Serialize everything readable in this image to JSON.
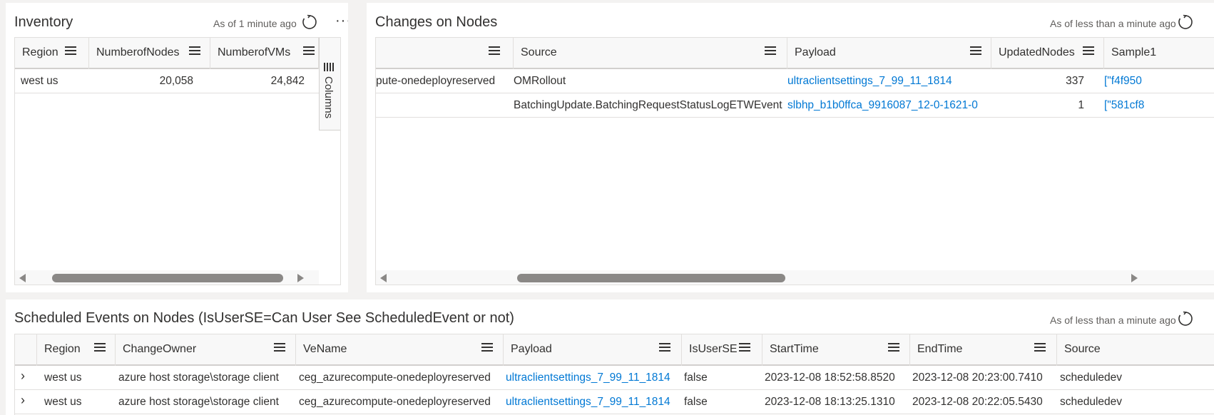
{
  "inventory": {
    "title": "Inventory",
    "status": "As of 1 minute ago",
    "more": "···",
    "columns": [
      "Region",
      "NumberofNodes",
      "NumberofVMs"
    ],
    "rows": [
      {
        "region": "west us",
        "nodes": "20,058",
        "vms": "24,842"
      }
    ],
    "columns_panel_label": "Columns"
  },
  "changes": {
    "title": "Changes on Nodes",
    "status": "As of less than a minute ago",
    "columns": [
      "",
      "Source",
      "Payload",
      "UpdatedNodes",
      "Sample1"
    ],
    "rows": [
      {
        "c0": "pute-onedeployreserved",
        "source": "OMRollout",
        "payload": "ultraclientsettings_7_99_11_1814",
        "updated": "337",
        "sample": "[\"f4f950"
      },
      {
        "c0": "",
        "source": "BatchingUpdate.BatchingRequestStatusLogETWEvent",
        "payload": "slbhp_b1b0ffca_9916087_12-0-1621-0",
        "updated": "1",
        "sample": "[\"581cf8"
      }
    ]
  },
  "scheduled": {
    "title": "Scheduled Events on Nodes (IsUserSE=Can User See ScheduledEvent or not)",
    "status": "As of less than a minute ago",
    "columns": [
      "Region",
      "ChangeOwner",
      "VeName",
      "Payload",
      "IsUserSE",
      "StartTime",
      "EndTime",
      "Source"
    ],
    "rows": [
      {
        "expand": "›",
        "region": "west us",
        "owner": "azure host storage\\storage client",
        "vename": "ceg_azurecompute-onedeployreserved",
        "payload": "ultraclientsettings_7_99_11_1814",
        "isuser": "false",
        "start": "2023-12-08 18:52:58.8520",
        "end": "2023-12-08 20:23:00.7410",
        "source": "scheduledev"
      },
      {
        "expand": "›",
        "region": "west us",
        "owner": "azure host storage\\storage client",
        "vename": "ceg_azurecompute-onedeployreserved",
        "payload": "ultraclientsettings_7_99_11_1814",
        "isuser": "false",
        "start": "2023-12-08 18:13:25.1310",
        "end": "2023-12-08 20:22:05.5430",
        "source": "scheduledev"
      }
    ]
  },
  "colors": {
    "link": "#0078d4",
    "text": "#323130",
    "muted": "#605e5c",
    "background": "#f3f2f1"
  },
  "icons": {
    "refresh": "refresh-icon",
    "menu": "column-menu-icon",
    "more": "more-icon",
    "expand": "chevron-right-icon",
    "columns": "columns-icon"
  }
}
